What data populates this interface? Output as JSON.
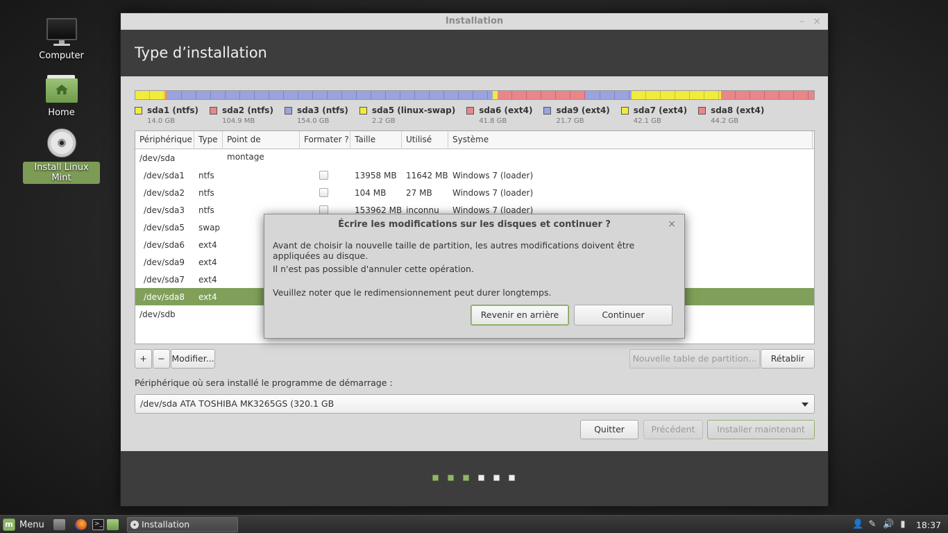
{
  "desktop": {
    "icons": [
      {
        "label": "Computer"
      },
      {
        "label": "Home"
      },
      {
        "label": "Install Linux Mint"
      }
    ]
  },
  "window": {
    "title": "Installation",
    "minimize": "–",
    "close": "×",
    "header": "Type d’installation"
  },
  "partition_bar": [
    {
      "name": "sda1 (ntfs)",
      "size": "14.0 GB",
      "gb": 14.0,
      "color": "#f0ec3c"
    },
    {
      "name": "sda2 (ntfs)",
      "size": "104.9 MB",
      "gb": 0.1,
      "color": "#e9868a"
    },
    {
      "name": "sda3 (ntfs)",
      "size": "154.0 GB",
      "gb": 154.0,
      "color": "#9aa3e0"
    },
    {
      "name": "sda5 (linux-swap)",
      "size": "2.2 GB",
      "gb": 2.2,
      "color": "#f0ec3c"
    },
    {
      "name": "sda6 (ext4)",
      "size": "41.8 GB",
      "gb": 41.8,
      "color": "#e9868a"
    },
    {
      "name": "sda9 (ext4)",
      "size": "21.7 GB",
      "gb": 21.7,
      "color": "#9aa3e0"
    },
    {
      "name": "sda7 (ext4)",
      "size": "42.1 GB",
      "gb": 42.1,
      "color": "#f0ec3c"
    },
    {
      "name": "sda8 (ext4)",
      "size": "44.2 GB",
      "gb": 44.2,
      "color": "#e9868a"
    }
  ],
  "table": {
    "headers": [
      "Périphérique",
      "Type",
      "Point de montage",
      "Formater ?",
      "Taille",
      "Utilisé",
      "Système"
    ],
    "rows": [
      {
        "device": "/dev/sda",
        "type": "",
        "mount": "",
        "format": false,
        "size": "",
        "used": "",
        "system": "",
        "disk": true
      },
      {
        "device": "/dev/sda1",
        "type": "ntfs",
        "mount": "",
        "format": true,
        "size": "13958 MB",
        "used": "11642 MB",
        "system": "Windows 7 (loader)"
      },
      {
        "device": "/dev/sda2",
        "type": "ntfs",
        "mount": "",
        "format": true,
        "size": "104 MB",
        "used": "27 MB",
        "system": "Windows 7 (loader)"
      },
      {
        "device": "/dev/sda3",
        "type": "ntfs",
        "mount": "",
        "format": true,
        "size": "153962 MB",
        "used": "inconnu",
        "system": "Windows 7 (loader)"
      },
      {
        "device": "/dev/sda5",
        "type": "swap",
        "mount": "",
        "format": false,
        "size": "",
        "used": "",
        "system": ""
      },
      {
        "device": "/dev/sda6",
        "type": "ext4",
        "mount": "",
        "format": false,
        "size": "",
        "used": "",
        "system": ""
      },
      {
        "device": "/dev/sda9",
        "type": "ext4",
        "mount": "",
        "format": false,
        "size": "",
        "used": "",
        "system": ""
      },
      {
        "device": "/dev/sda7",
        "type": "ext4",
        "mount": "",
        "format": false,
        "size": "",
        "used": "",
        "system": ""
      },
      {
        "device": "/dev/sda8",
        "type": "ext4",
        "mount": "",
        "format": false,
        "size": "",
        "used": "",
        "system": "",
        "selected": true
      },
      {
        "device": "/dev/sdb",
        "type": "",
        "mount": "",
        "format": false,
        "size": "",
        "used": "",
        "system": "",
        "disk": true
      }
    ]
  },
  "toolbar": {
    "add": "+",
    "remove": "−",
    "modify": "Modifier...",
    "new_table": "Nouvelle table de partition...",
    "revert": "Rétablir"
  },
  "boot": {
    "label": "Périphérique où sera installé le programme de démarrage :",
    "selected": "/dev/sda   ATA TOSHIBA MK3265GS (320.1 GB"
  },
  "nav": {
    "quit": "Quitter",
    "previous": "Précédent",
    "install": "Installer maintenant"
  },
  "progress": {
    "total_steps": 6,
    "completed_steps": 3
  },
  "dialog": {
    "title": "Écrire les modifications sur les disques et continuer ?",
    "close": "×",
    "line1": "Avant de choisir la nouvelle taille de partition, les autres modifications doivent être appliquées au disque.",
    "line2": "Il n'est pas possible d'annuler cette opération.",
    "line3": "Veuillez noter que le redimensionnement peut durer longtemps.",
    "back": "Revenir en arrière",
    "continue": "Continuer"
  },
  "taskbar": {
    "menu": "Menu",
    "task": "Installation",
    "clock": "18:37"
  },
  "colors": {
    "accent": "#80a05a",
    "header_bg": "#3d3d3d"
  }
}
